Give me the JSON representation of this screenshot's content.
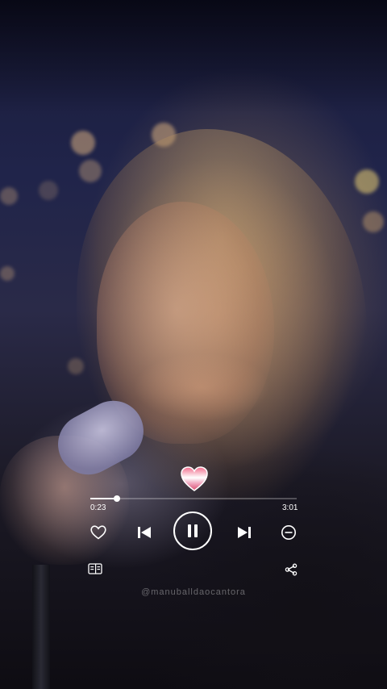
{
  "player": {
    "elapsed_time": "0:23",
    "total_time": "3:01",
    "progress_fraction": 0.127
  },
  "controls": {
    "like_icon": "heart-outline-icon",
    "previous_icon": "skip-previous-icon",
    "play_pause_icon": "pause-icon",
    "next_icon": "skip-next-icon",
    "remove_icon": "minus-circle-icon",
    "lyrics_icon": "lyrics-icon",
    "share_icon": "share-icon"
  },
  "sticker": {
    "icon": "heart-sticker-icon",
    "colors": [
      "#ffffff",
      "#f0a4bd",
      "#d84e6f"
    ]
  },
  "watermark": {
    "text": "@manuballdaocantora"
  },
  "colors": {
    "control": "#ffffff",
    "track": "rgba(255,255,255,0.25)"
  }
}
